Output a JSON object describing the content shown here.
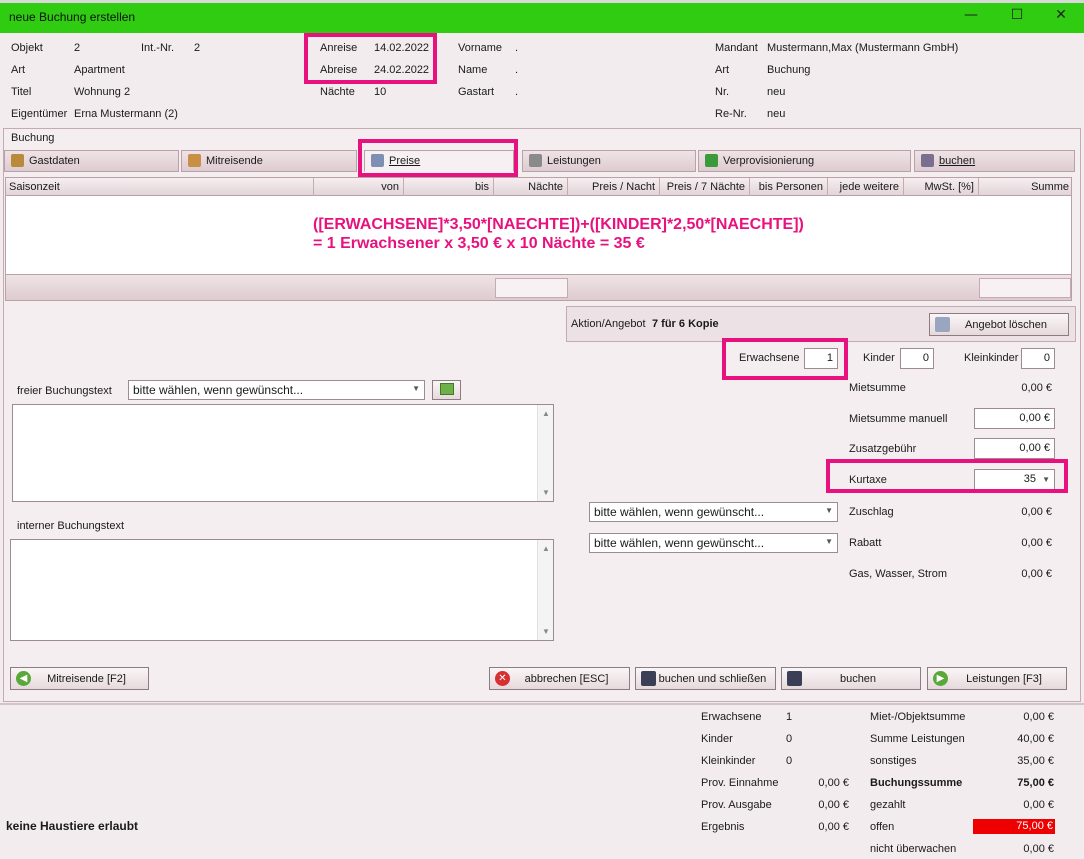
{
  "window": {
    "title": "neue Buchung erstellen",
    "minimize": "—",
    "maximize": "☐",
    "close": "✕"
  },
  "header": {
    "objekt_label": "Objekt",
    "objekt_value": "2",
    "intnr_label": "Int.-Nr.",
    "intnr_value": "2",
    "art_label": "Art",
    "art_value": "Apartment",
    "titel_label": "Titel",
    "titel_value": "Wohnung 2",
    "eigentuemer_label": "Eigentümer",
    "eigentuemer_value": "Erna Mustermann (2)",
    "anreise_label": "Anreise",
    "anreise_value": "14.02.2022",
    "abreise_label": "Abreise",
    "abreise_value": "24.02.2022",
    "naechte_label": "Nächte",
    "naechte_value": "10",
    "vorname_label": "Vorname",
    "vorname_value": ".",
    "name_label": "Name",
    "name_value": ".",
    "gastart_label": "Gastart",
    "gastart_value": ".",
    "mandant_label": "Mandant",
    "mandant_value": "Mustermann,Max (Mustermann GmbH)",
    "art2_label": "Art",
    "art2_value": "Buchung",
    "nr_label": "Nr.",
    "nr_value": "neu",
    "renr_label": "Re-Nr.",
    "renr_value": "neu"
  },
  "section_label": "Buchung",
  "tabs": [
    "Gastdaten",
    "Mitreisende",
    "Preise",
    "Leistungen",
    "Verprovisionierung",
    "buchen"
  ],
  "grid": {
    "columns": [
      "Saisonzeit",
      "von",
      "bis",
      "Nächte",
      "Preis / Nacht",
      "Preis / 7 Nächte",
      "bis Personen",
      "jede weitere",
      "MwSt. [%]",
      "Summe"
    ]
  },
  "annotation": {
    "line1": "([ERWACHSENE]*3,50*[NAECHTE])+([KINDER]*2,50*[NAECHTE])",
    "line2": "= 1 Erwachsener x 3,50 € x 10 Nächte = 35 €"
  },
  "aktion": {
    "label": "Aktion/Angebot",
    "value": "7 für 6 Kopie",
    "button": "Angebot löschen"
  },
  "persons": {
    "erwachsene_label": "Erwachsene",
    "erwachsene": "1",
    "kinder_label": "Kinder",
    "kinder": "0",
    "kleinkinder_label": "Kleinkinder",
    "kleinkinder": "0"
  },
  "prices": {
    "mietsumme_label": "Mietsumme",
    "mietsumme": "0,00 €",
    "mietsumme_manuell_label": "Mietsumme manuell",
    "mietsumme_manuell": "0,00 €",
    "zusatzgebuehr_label": "Zusatzgebühr",
    "zusatzgebuehr": "0,00 €",
    "kurtaxe_label": "Kurtaxe",
    "kurtaxe": "35",
    "zuschlag_label": "Zuschlag",
    "zuschlag": "0,00 €",
    "rabatt_label": "Rabatt",
    "rabatt": "0,00 €",
    "gas_label": "Gas, Wasser, Strom",
    "gas": "0,00 €"
  },
  "texts": {
    "frei_label": "freier Buchungstext",
    "select_placeholder": "bitte wählen, wenn gewünscht...",
    "intern_label": "interner Buchungstext"
  },
  "buttons": {
    "mitreisende": "Mitreisende [F2]",
    "abbrechen": "abbrechen [ESC]",
    "buchen_schliessen": "buchen und schließen",
    "buchen": "buchen",
    "leistungen": "Leistungen [F3]"
  },
  "summary": {
    "note": "keine Haustiere erlaubt",
    "erwachsene_label": "Erwachsene",
    "erwachsene": "1",
    "kinder_label": "Kinder",
    "kinder": "0",
    "kleinkinder_label": "Kleinkinder",
    "kleinkinder": "0",
    "prov_einnahme_label": "Prov. Einnahme",
    "prov_einnahme": "0,00 €",
    "prov_ausgabe_label": "Prov. Ausgabe",
    "prov_ausgabe": "0,00 €",
    "ergebnis_label": "Ergebnis",
    "ergebnis": "0,00 €",
    "miet_label": "Miet-/Objektsumme",
    "miet": "0,00 €",
    "leistungen_label": "Summe Leistungen",
    "leistungen": "40,00 €",
    "sonstiges_label": "sonstiges",
    "sonstiges": "35,00 €",
    "buchungssumme_label": "Buchungssumme",
    "buchungssumme": "75,00 €",
    "gezahlt_label": "gezahlt",
    "gezahlt": "0,00 €",
    "offen_label": "offen",
    "offen": "75,00 €",
    "nicht_label": "nicht überwachen",
    "nicht": "0,00 €"
  },
  "colors": {
    "titlebar": "#2fcc12",
    "highlight": "#e8127f",
    "offen_bg": "#ee0000"
  }
}
